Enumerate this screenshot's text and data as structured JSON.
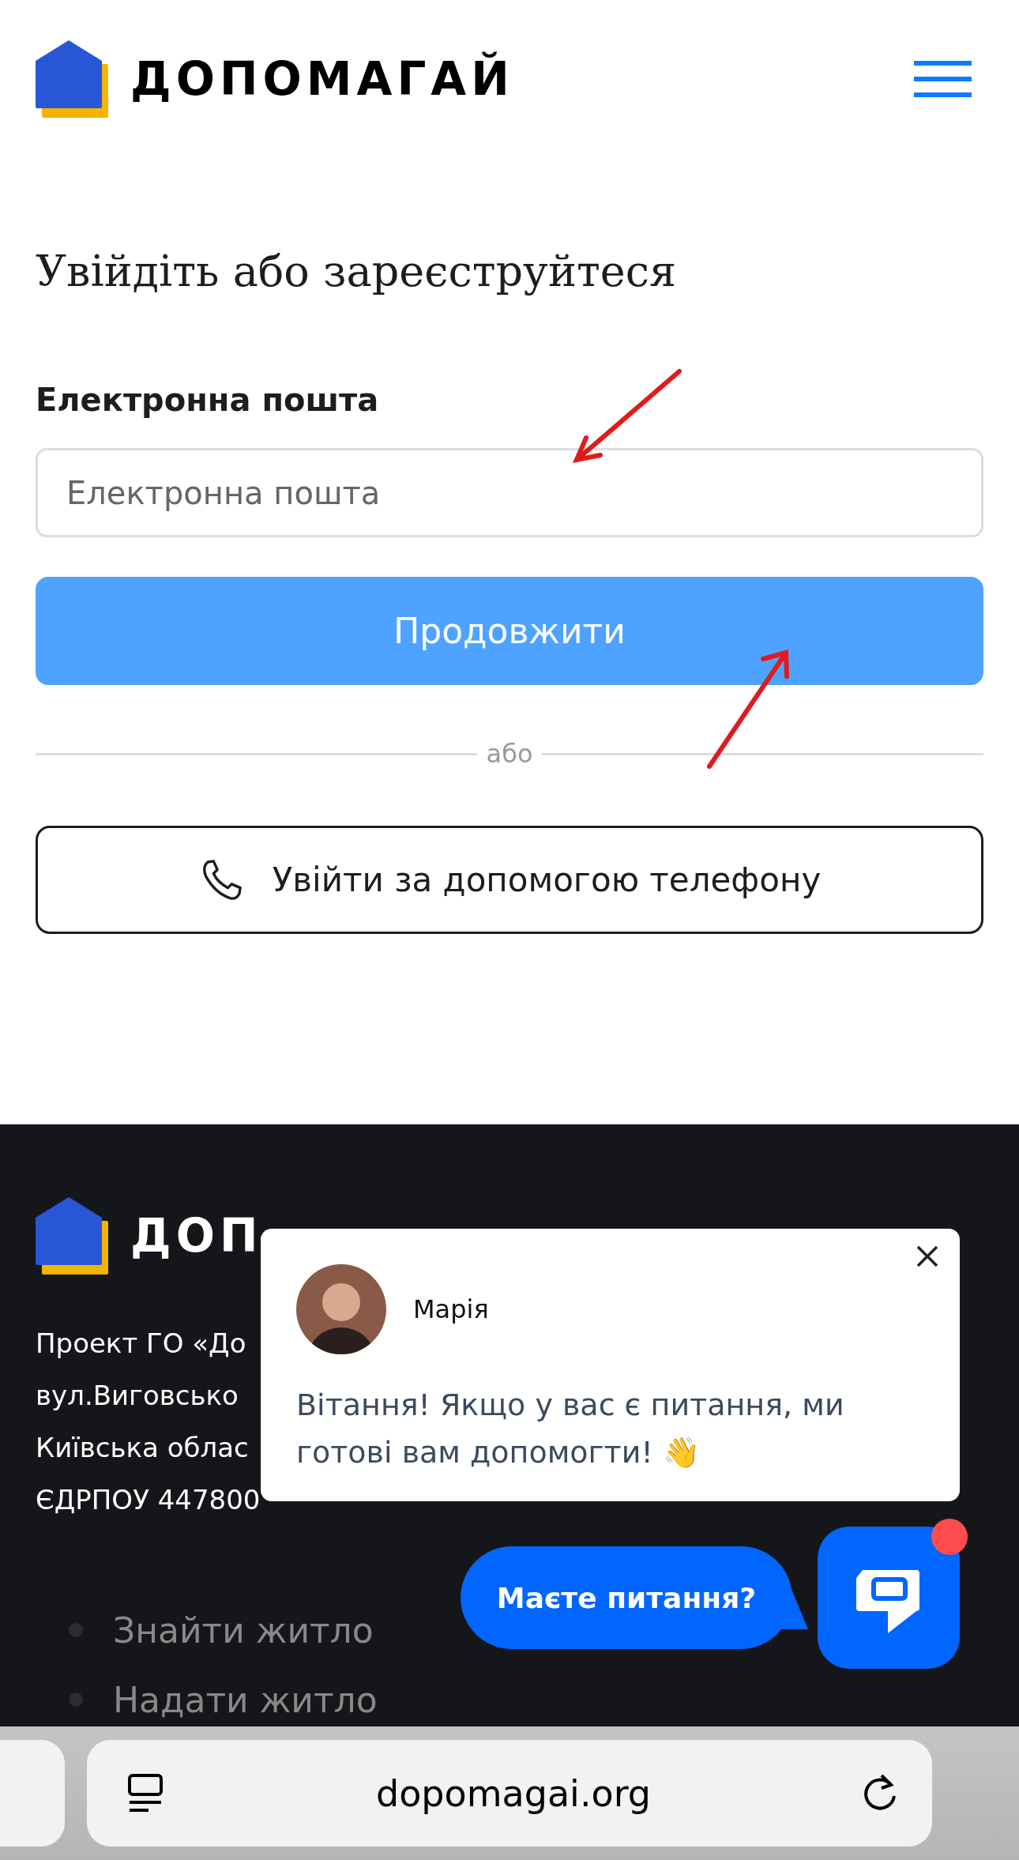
{
  "header": {
    "logo_text": "ДОПОМАГАЙ"
  },
  "login": {
    "title": "Увійдіть або зареєструйтеся",
    "email_field": {
      "label": "Електронна пошта",
      "placeholder": "Електронна пошта"
    },
    "continue_button": "Продовжити",
    "divider": "або",
    "phone_button": "Увійти за допомогою телефону"
  },
  "footer": {
    "logo_text": "ДОП",
    "address_lines": [
      "Проект ГО «До",
      "вул.Виговсько",
      "Київська облас",
      "ЄДРПОУ 447800"
    ],
    "links": [
      "Знайти житло",
      "Надати житло"
    ]
  },
  "chat_popup": {
    "name": "Марія",
    "message": "Вітання! Якщо у вас є питання, ми готові вам допомогти! 👋"
  },
  "chat_launcher": {
    "prompt": "Маєте питання?",
    "unread": true
  },
  "browser_bar": {
    "url": "dopomagai.org"
  }
}
